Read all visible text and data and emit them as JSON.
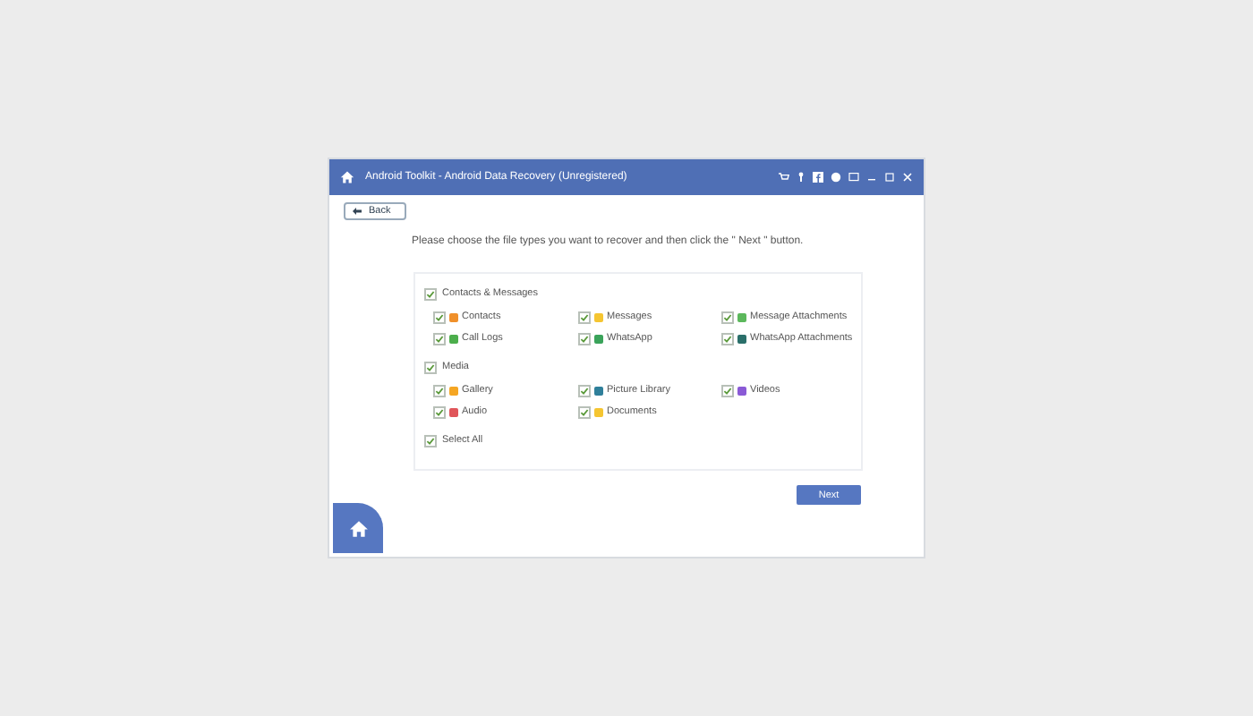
{
  "window": {
    "title": "Android Toolkit - Android Data Recovery (Unregistered)"
  },
  "back_button": "Back",
  "instruction": "Please choose the file types you want to recover and then click the \" Next \" button.",
  "groups": [
    {
      "label": "Contacts & Messages",
      "checked": true,
      "items": [
        {
          "label": "Contacts",
          "checked": true,
          "color": "#f0902a"
        },
        {
          "label": "Messages",
          "checked": true,
          "color": "#f5c531"
        },
        {
          "label": "Message Attachments",
          "checked": true,
          "color": "#5cb85c"
        },
        {
          "label": "Call Logs",
          "checked": true,
          "color": "#4cae4c"
        },
        {
          "label": "WhatsApp",
          "checked": true,
          "color": "#3aa35a"
        },
        {
          "label": "WhatsApp Attachments",
          "checked": true,
          "color": "#2a6f6a"
        }
      ]
    },
    {
      "label": "Media",
      "checked": true,
      "items": [
        {
          "label": "Gallery",
          "checked": true,
          "color": "#f5a623"
        },
        {
          "label": "Picture Library",
          "checked": true,
          "color": "#2f7f9a"
        },
        {
          "label": "Videos",
          "checked": true,
          "color": "#8a5ad6"
        },
        {
          "label": "Audio",
          "checked": true,
          "color": "#e0555a"
        },
        {
          "label": "Documents",
          "checked": true,
          "color": "#f5c531"
        }
      ]
    }
  ],
  "select_all": {
    "label": "Select All",
    "checked": true
  },
  "next_button": "Next"
}
